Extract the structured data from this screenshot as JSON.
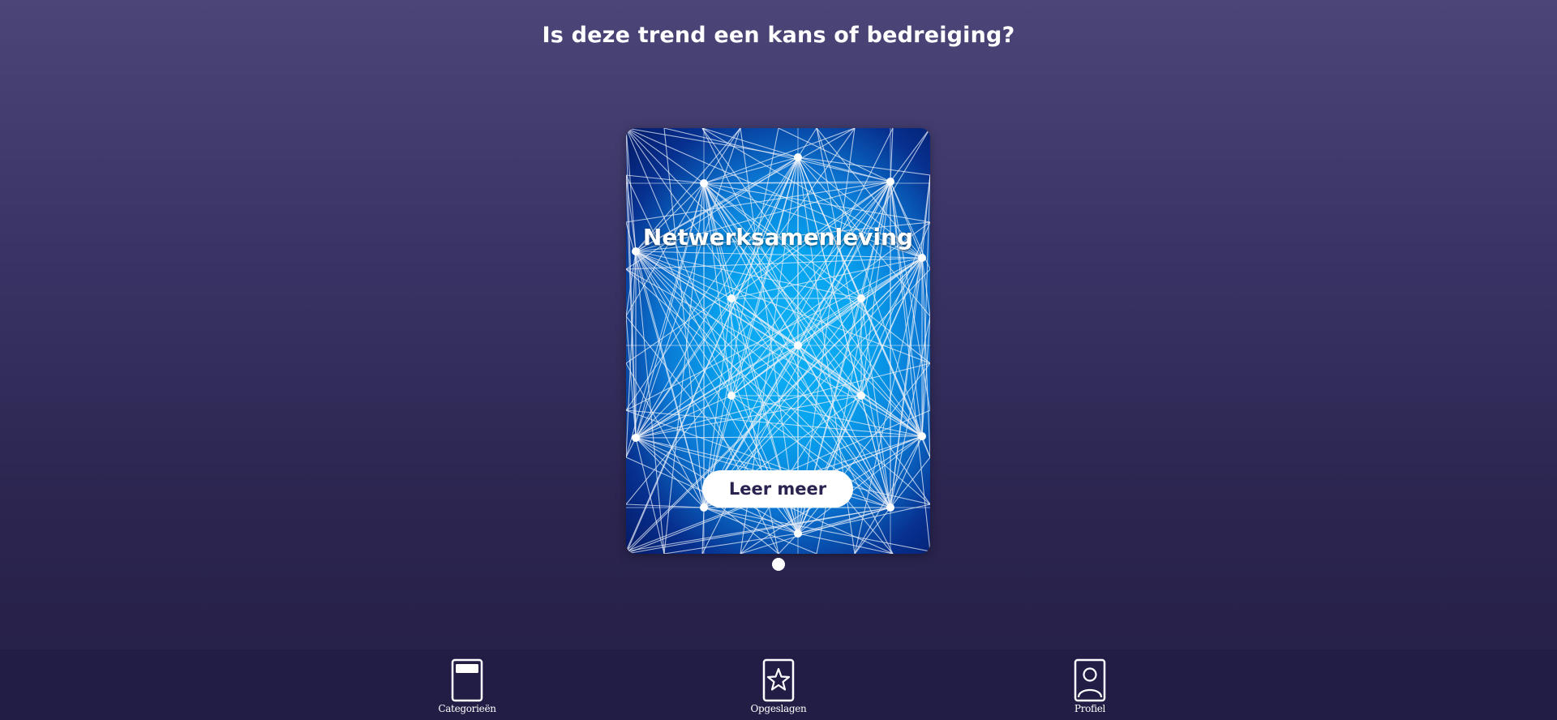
{
  "header": {
    "title": "Is deze trend een kans of bedreiging?"
  },
  "card": {
    "title": "Netwerksamenleving",
    "button_label": "Leer meer",
    "image": "network-lines-illustration"
  },
  "pagination": {
    "count": 1,
    "active": 1
  },
  "nav": {
    "items": [
      {
        "label": "Categorieën",
        "icon": "card-icon"
      },
      {
        "label": "Opgeslagen",
        "icon": "star-card-icon"
      },
      {
        "label": "Profiel",
        "icon": "profile-card-icon"
      }
    ]
  },
  "colors": {
    "background_top": "#4b4677",
    "background_bottom": "#252046",
    "nav_background": "#221d44",
    "card_blue": "#07a3ef",
    "button_text": "#2a2350"
  }
}
